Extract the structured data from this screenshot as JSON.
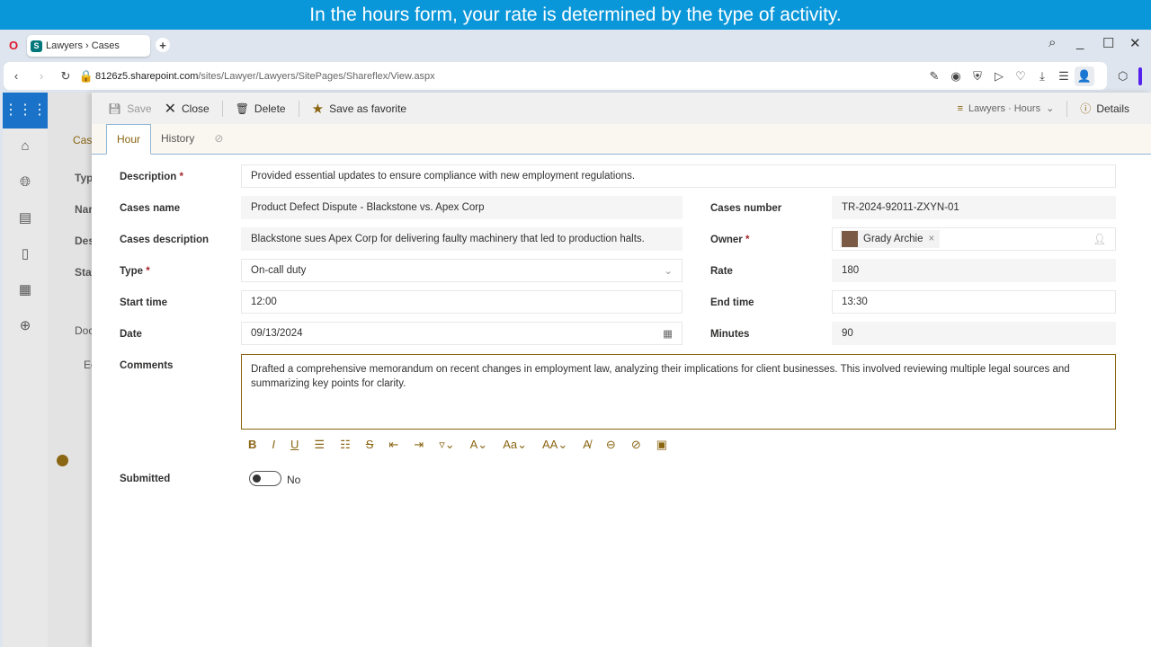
{
  "banner": "In the hours form, your rate is determined by the type of activity.",
  "browser": {
    "tab_title": "Lawyers › Cases",
    "url_host": "8126z5.sharepoint.com",
    "url_path": "/sites/Lawyer/Lawyers/SitePages/Shareflex/View.aspx"
  },
  "toolbar": {
    "save": "Save",
    "close": "Close",
    "delete": "Delete",
    "favorite": "Save as favorite",
    "view": "Lawyers · Hours",
    "details": "Details"
  },
  "tabs": [
    "Hour",
    "History"
  ],
  "background": {
    "tab": "Case",
    "labels": [
      "Typ",
      "Nar",
      "Des",
      "Stat"
    ],
    "docs": "Doc",
    "edit": "Ed"
  },
  "form": {
    "description": {
      "label": "Description",
      "value": "Provided essential updates to ensure compliance with new employment regulations."
    },
    "cases_name": {
      "label": "Cases name",
      "value": "Product Defect Dispute - Blackstone vs. Apex Corp"
    },
    "cases_description": {
      "label": "Cases description",
      "value": "Blackstone sues Apex Corp for delivering faulty machinery that led to production halts."
    },
    "type": {
      "label": "Type",
      "value": "On-call duty"
    },
    "start_time": {
      "label": "Start time",
      "value": "12:00"
    },
    "date": {
      "label": "Date",
      "value": "09/13/2024"
    },
    "cases_number": {
      "label": "Cases number",
      "value": "TR-2024-92011-ZXYN-01"
    },
    "owner": {
      "label": "Owner",
      "value": "Grady Archie"
    },
    "rate": {
      "label": "Rate",
      "value": "180"
    },
    "end_time": {
      "label": "End time",
      "value": "13:30"
    },
    "minutes": {
      "label": "Minutes",
      "value": "90"
    },
    "comments": {
      "label": "Comments",
      "value": "Drafted a comprehensive memorandum on recent changes in employment law, analyzing their implications for client businesses. This involved reviewing multiple legal sources and summarizing key points for clarity."
    },
    "submitted": {
      "label": "Submitted",
      "value": "No",
      "on": false
    }
  },
  "colors": {
    "accent": "#8a6512",
    "banner": "#0a97d9",
    "sp_blue": "#1a73c8"
  }
}
